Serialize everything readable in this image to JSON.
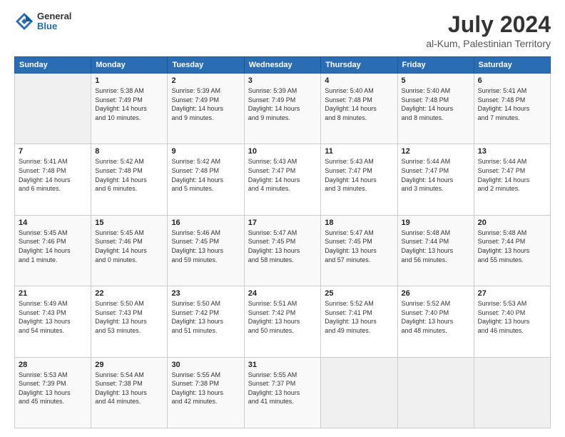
{
  "header": {
    "logo_general": "General",
    "logo_blue": "Blue",
    "month": "July 2024",
    "location": "al-Kum, Palestinian Territory"
  },
  "weekdays": [
    "Sunday",
    "Monday",
    "Tuesday",
    "Wednesday",
    "Thursday",
    "Friday",
    "Saturday"
  ],
  "weeks": [
    [
      {
        "day": "",
        "info": ""
      },
      {
        "day": "1",
        "info": "Sunrise: 5:38 AM\nSunset: 7:49 PM\nDaylight: 14 hours\nand 10 minutes."
      },
      {
        "day": "2",
        "info": "Sunrise: 5:39 AM\nSunset: 7:49 PM\nDaylight: 14 hours\nand 9 minutes."
      },
      {
        "day": "3",
        "info": "Sunrise: 5:39 AM\nSunset: 7:49 PM\nDaylight: 14 hours\nand 9 minutes."
      },
      {
        "day": "4",
        "info": "Sunrise: 5:40 AM\nSunset: 7:48 PM\nDaylight: 14 hours\nand 8 minutes."
      },
      {
        "day": "5",
        "info": "Sunrise: 5:40 AM\nSunset: 7:48 PM\nDaylight: 14 hours\nand 8 minutes."
      },
      {
        "day": "6",
        "info": "Sunrise: 5:41 AM\nSunset: 7:48 PM\nDaylight: 14 hours\nand 7 minutes."
      }
    ],
    [
      {
        "day": "7",
        "info": "Sunrise: 5:41 AM\nSunset: 7:48 PM\nDaylight: 14 hours\nand 6 minutes."
      },
      {
        "day": "8",
        "info": "Sunrise: 5:42 AM\nSunset: 7:48 PM\nDaylight: 14 hours\nand 6 minutes."
      },
      {
        "day": "9",
        "info": "Sunrise: 5:42 AM\nSunset: 7:48 PM\nDaylight: 14 hours\nand 5 minutes."
      },
      {
        "day": "10",
        "info": "Sunrise: 5:43 AM\nSunset: 7:47 PM\nDaylight: 14 hours\nand 4 minutes."
      },
      {
        "day": "11",
        "info": "Sunrise: 5:43 AM\nSunset: 7:47 PM\nDaylight: 14 hours\nand 3 minutes."
      },
      {
        "day": "12",
        "info": "Sunrise: 5:44 AM\nSunset: 7:47 PM\nDaylight: 14 hours\nand 3 minutes."
      },
      {
        "day": "13",
        "info": "Sunrise: 5:44 AM\nSunset: 7:47 PM\nDaylight: 14 hours\nand 2 minutes."
      }
    ],
    [
      {
        "day": "14",
        "info": "Sunrise: 5:45 AM\nSunset: 7:46 PM\nDaylight: 14 hours\nand 1 minute."
      },
      {
        "day": "15",
        "info": "Sunrise: 5:45 AM\nSunset: 7:46 PM\nDaylight: 14 hours\nand 0 minutes."
      },
      {
        "day": "16",
        "info": "Sunrise: 5:46 AM\nSunset: 7:45 PM\nDaylight: 13 hours\nand 59 minutes."
      },
      {
        "day": "17",
        "info": "Sunrise: 5:47 AM\nSunset: 7:45 PM\nDaylight: 13 hours\nand 58 minutes."
      },
      {
        "day": "18",
        "info": "Sunrise: 5:47 AM\nSunset: 7:45 PM\nDaylight: 13 hours\nand 57 minutes."
      },
      {
        "day": "19",
        "info": "Sunrise: 5:48 AM\nSunset: 7:44 PM\nDaylight: 13 hours\nand 56 minutes."
      },
      {
        "day": "20",
        "info": "Sunrise: 5:48 AM\nSunset: 7:44 PM\nDaylight: 13 hours\nand 55 minutes."
      }
    ],
    [
      {
        "day": "21",
        "info": "Sunrise: 5:49 AM\nSunset: 7:43 PM\nDaylight: 13 hours\nand 54 minutes."
      },
      {
        "day": "22",
        "info": "Sunrise: 5:50 AM\nSunset: 7:43 PM\nDaylight: 13 hours\nand 53 minutes."
      },
      {
        "day": "23",
        "info": "Sunrise: 5:50 AM\nSunset: 7:42 PM\nDaylight: 13 hours\nand 51 minutes."
      },
      {
        "day": "24",
        "info": "Sunrise: 5:51 AM\nSunset: 7:42 PM\nDaylight: 13 hours\nand 50 minutes."
      },
      {
        "day": "25",
        "info": "Sunrise: 5:52 AM\nSunset: 7:41 PM\nDaylight: 13 hours\nand 49 minutes."
      },
      {
        "day": "26",
        "info": "Sunrise: 5:52 AM\nSunset: 7:40 PM\nDaylight: 13 hours\nand 48 minutes."
      },
      {
        "day": "27",
        "info": "Sunrise: 5:53 AM\nSunset: 7:40 PM\nDaylight: 13 hours\nand 46 minutes."
      }
    ],
    [
      {
        "day": "28",
        "info": "Sunrise: 5:53 AM\nSunset: 7:39 PM\nDaylight: 13 hours\nand 45 minutes."
      },
      {
        "day": "29",
        "info": "Sunrise: 5:54 AM\nSunset: 7:38 PM\nDaylight: 13 hours\nand 44 minutes."
      },
      {
        "day": "30",
        "info": "Sunrise: 5:55 AM\nSunset: 7:38 PM\nDaylight: 13 hours\nand 42 minutes."
      },
      {
        "day": "31",
        "info": "Sunrise: 5:55 AM\nSunset: 7:37 PM\nDaylight: 13 hours\nand 41 minutes."
      },
      {
        "day": "",
        "info": ""
      },
      {
        "day": "",
        "info": ""
      },
      {
        "day": "",
        "info": ""
      }
    ]
  ]
}
